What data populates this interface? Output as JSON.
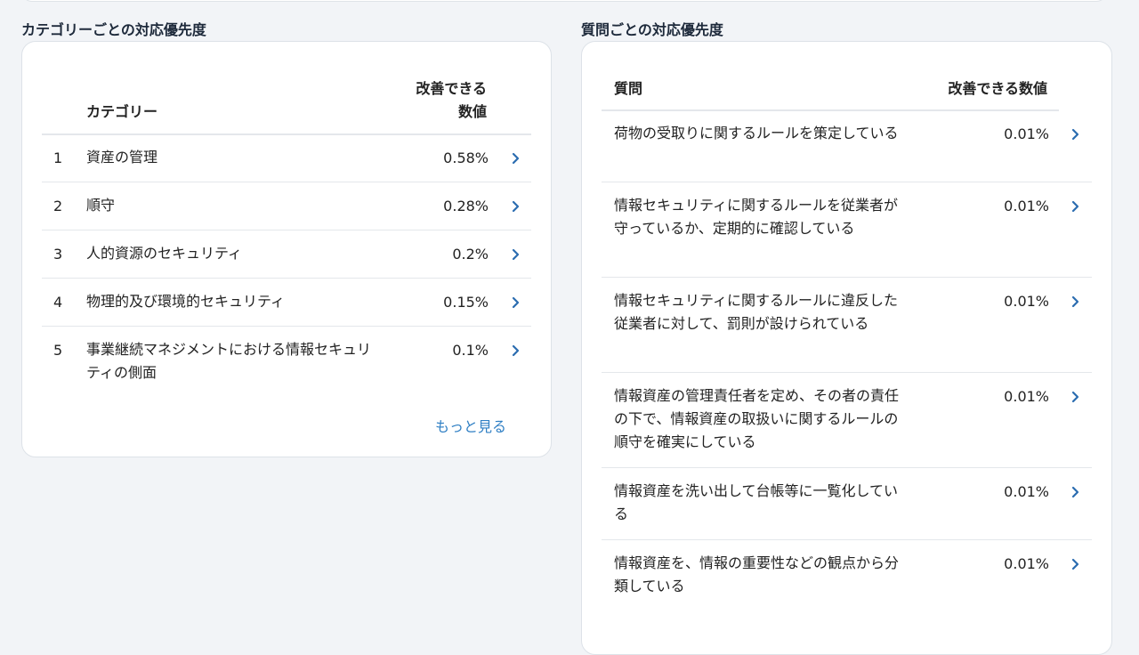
{
  "left": {
    "title": "カテゴリーごとの対応優先度",
    "header_category": "カテゴリー",
    "header_value_line1": "改善できる",
    "header_value_line2": "数値",
    "rows": [
      {
        "rank": "1",
        "label": "資産の管理",
        "value": "0.58%"
      },
      {
        "rank": "2",
        "label": "順守",
        "value": "0.28%"
      },
      {
        "rank": "3",
        "label": "人的資源のセキュリティ",
        "value": "0.2%"
      },
      {
        "rank": "4",
        "label": "物理的及び環境的セキュリティ",
        "value": "0.15%"
      },
      {
        "rank": "5",
        "label": "事業継続マネジメントにおける情報セキュリティの側面",
        "value": "0.1%"
      }
    ],
    "more_label": "もっと見る"
  },
  "right": {
    "title": "質問ごとの対応優先度",
    "header_question": "質問",
    "header_value": "改善できる数値",
    "rows": [
      {
        "label": "荷物の受取りに関するルールを策定している",
        "value": "0.01%"
      },
      {
        "label": "情報セキュリティに関するルールを従業者が守っているか、定期的に確認している",
        "value": "0.01%"
      },
      {
        "label": "情報セキュリティに関するルールに違反した従業者に対して、罰則が設けられている",
        "value": "0.01%"
      },
      {
        "label": "情報資産の管理責任者を定め、その者の責任の下で、情報資産の取扱いに関するルールの順守を確実にしている",
        "value": "0.01%"
      },
      {
        "label": "情報資産を洗い出して台帳等に一覧化している",
        "value": "0.01%"
      },
      {
        "label": "情報資産を、情報の重要性などの観点から分類している",
        "value": "0.01%"
      }
    ]
  },
  "colors": {
    "accent": "#2f7fc4",
    "chevron": "#2b6cb0",
    "divider": "#e4e7eb"
  },
  "icons": {
    "row_action": "chevron-right-icon"
  }
}
